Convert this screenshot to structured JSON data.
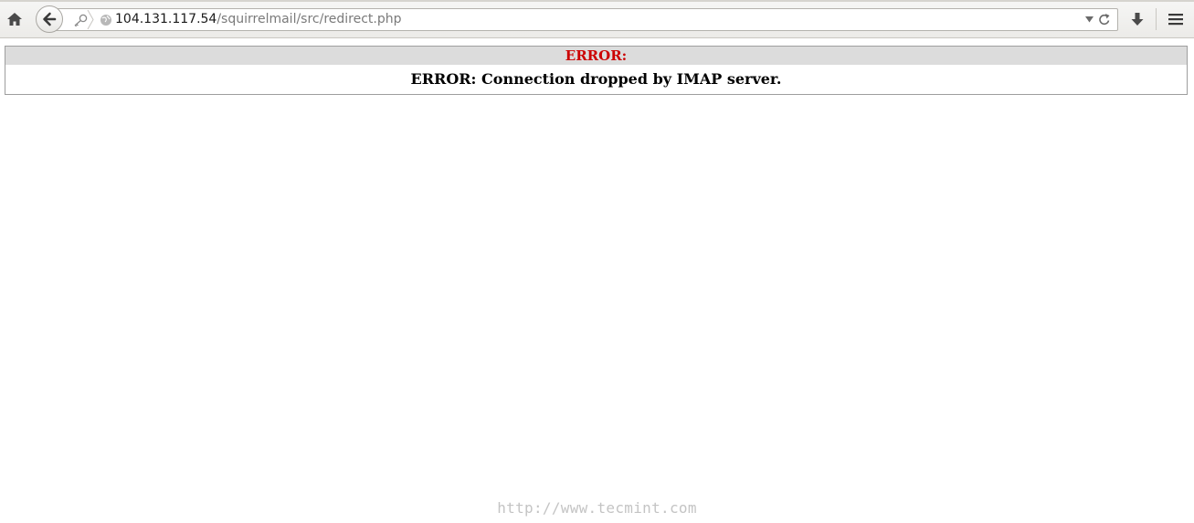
{
  "browser": {
    "url_host": "104.131.117.54",
    "url_path": "/squirrelmail/src/redirect.php",
    "icons": {
      "home": "home-icon",
      "back": "back-arrow-icon",
      "identity": "key-icon",
      "site": "globe-icon",
      "dropdown": "chevron-down-icon",
      "reload": "reload-icon",
      "downloads": "download-icon",
      "menu": "hamburger-menu-icon"
    }
  },
  "error": {
    "title": "ERROR:",
    "message": "ERROR: Connection dropped by IMAP server.",
    "title_color": "#cc0000",
    "header_bg": "#dcdcdc"
  },
  "watermark": {
    "text": "http://www.tecmint.com"
  }
}
